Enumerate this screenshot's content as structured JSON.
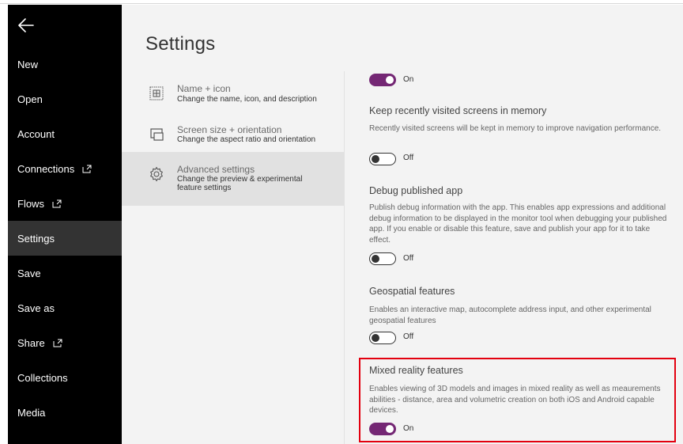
{
  "nav": {
    "items": [
      {
        "label": "New",
        "external": false
      },
      {
        "label": "Open",
        "external": false
      },
      {
        "label": "Account",
        "external": false
      },
      {
        "label": "Connections",
        "external": true
      },
      {
        "label": "Flows",
        "external": true
      },
      {
        "label": "Settings",
        "external": false,
        "active": true
      },
      {
        "label": "Save",
        "external": false
      },
      {
        "label": "Save as",
        "external": false
      },
      {
        "label": "Share",
        "external": true
      },
      {
        "label": "Collections",
        "external": false
      },
      {
        "label": "Media",
        "external": false
      }
    ]
  },
  "page": {
    "title": "Settings"
  },
  "categories": [
    {
      "title": "Name + icon",
      "desc": "Change the name, icon, and description",
      "icon": "name-icon"
    },
    {
      "title": "Screen size + orientation",
      "desc": "Change the aspect ratio and orientation",
      "icon": "screen-size-icon"
    },
    {
      "title": "Advanced settings",
      "desc": "Change the preview & experimental feature settings",
      "icon": "gear-icon",
      "active": true
    }
  ],
  "settings": [
    {
      "title": "",
      "desc": "",
      "state": "On"
    },
    {
      "title": "Keep recently visited screens in memory",
      "desc": "Recently visited screens will be kept in memory to improve navigation performance.",
      "state": "Off"
    },
    {
      "title": "Debug published app",
      "desc": "Publish debug information with the app. This enables app expressions and additional debug information to be displayed in the monitor tool when debugging your published app. If you enable or disable this feature, save and publish your app for it to take effect.",
      "state": "Off"
    },
    {
      "title": "Geospatial features",
      "desc": "Enables an interactive map, autocomplete address input, and other experimental geospatial features",
      "state": "Off"
    },
    {
      "title": "Mixed reality features",
      "desc": "Enables viewing of 3D models and images in mixed reality as well as meaurements abilities - distance, area and volumetric creation on both iOS and Android capable devices.",
      "state": "On"
    }
  ],
  "colors": {
    "accent": "#742774",
    "highlight": "#e3000f",
    "sidebar": "#000000"
  }
}
